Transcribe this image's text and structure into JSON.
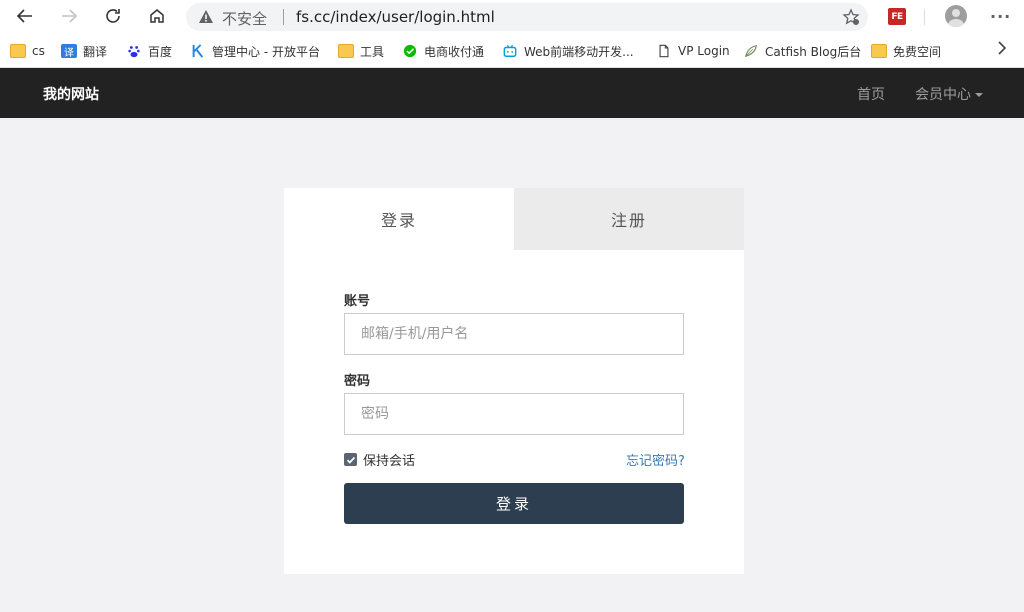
{
  "browser": {
    "url_insecure_label": "不安全",
    "url": "fs.cc/index/user/login.html",
    "extension_label": "FE",
    "more_label": "···"
  },
  "bookmarks": [
    {
      "label": "cs",
      "icon": "folder-icon"
    },
    {
      "label": "翻译",
      "icon": "translate-icon"
    },
    {
      "label": "百度",
      "icon": "baidu-icon"
    },
    {
      "label": "管理中心 - 开放平台",
      "icon": "k-logo-icon"
    },
    {
      "label": "工具",
      "icon": "folder-icon"
    },
    {
      "label": "电商收付通",
      "icon": "wechat-pay-icon"
    },
    {
      "label": "Web前端移动开发...",
      "icon": "bilibili-icon"
    },
    {
      "label": "VP Login",
      "icon": "page-icon"
    },
    {
      "label": "Catfish Blog后台",
      "icon": "leaf-icon"
    },
    {
      "label": "免费空间",
      "icon": "folder-icon"
    }
  ],
  "site": {
    "brand": "我的网站",
    "nav_home": "首页",
    "nav_member": "会员中心"
  },
  "login": {
    "tab_login": "登录",
    "tab_register": "注册",
    "account_label": "账号",
    "account_placeholder": "邮箱/手机/用户名",
    "password_label": "密码",
    "password_placeholder": "密码",
    "remember_label": "保持会话",
    "remember_checked": true,
    "forgot_label": "忘记密码?",
    "submit_label": "登录"
  },
  "colors": {
    "nav_bg": "#222222",
    "button_bg": "#2c3e50",
    "link": "#337ab7",
    "page_bg": "#f2f2f4"
  }
}
